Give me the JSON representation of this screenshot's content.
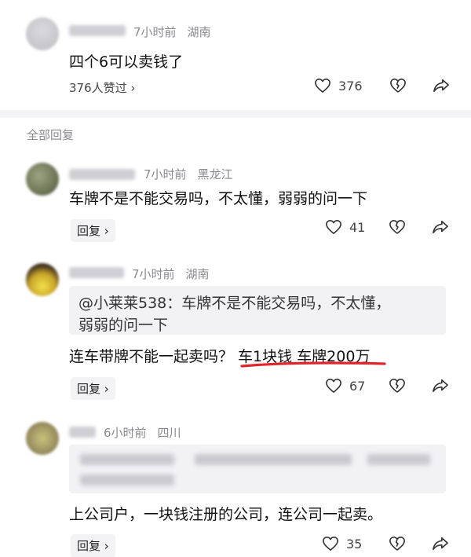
{
  "comment_main": {
    "time": "7小时前",
    "location": "湖南",
    "text": "四个6可以卖钱了",
    "likes_summary": "376人赞过 ›",
    "like_count": "376"
  },
  "section_title": "全部回复",
  "replies": [
    {
      "time": "7小时前",
      "location": "黑龙江",
      "text": "车牌不是不能交易吗，不太懂，弱弱的问一下",
      "reply_label": "回复 ›",
      "like_count": "41"
    },
    {
      "time": "7小时前",
      "location": "湖南",
      "quote_line1": "@小莱莱538：车牌不是不能交易吗，不太懂，",
      "quote_line2": "弱弱的问一下",
      "text_a": "连车带牌不能一起卖吗？ ",
      "text_b": "车1块钱 车牌200万",
      "reply_label": "回复 ›",
      "like_count": "67"
    },
    {
      "time": "6小时前",
      "location": "四川",
      "text": "上公司户，一块钱注册的公司，连公司一起卖。",
      "reply_label": "回复 ›",
      "like_count": "35"
    }
  ],
  "colors": {
    "underline": "#e0262c",
    "meta": "#8a8a8f",
    "quote_bg": "#f2f2f5"
  },
  "icons": [
    "heart-icon",
    "broken-heart-icon",
    "share-icon"
  ]
}
